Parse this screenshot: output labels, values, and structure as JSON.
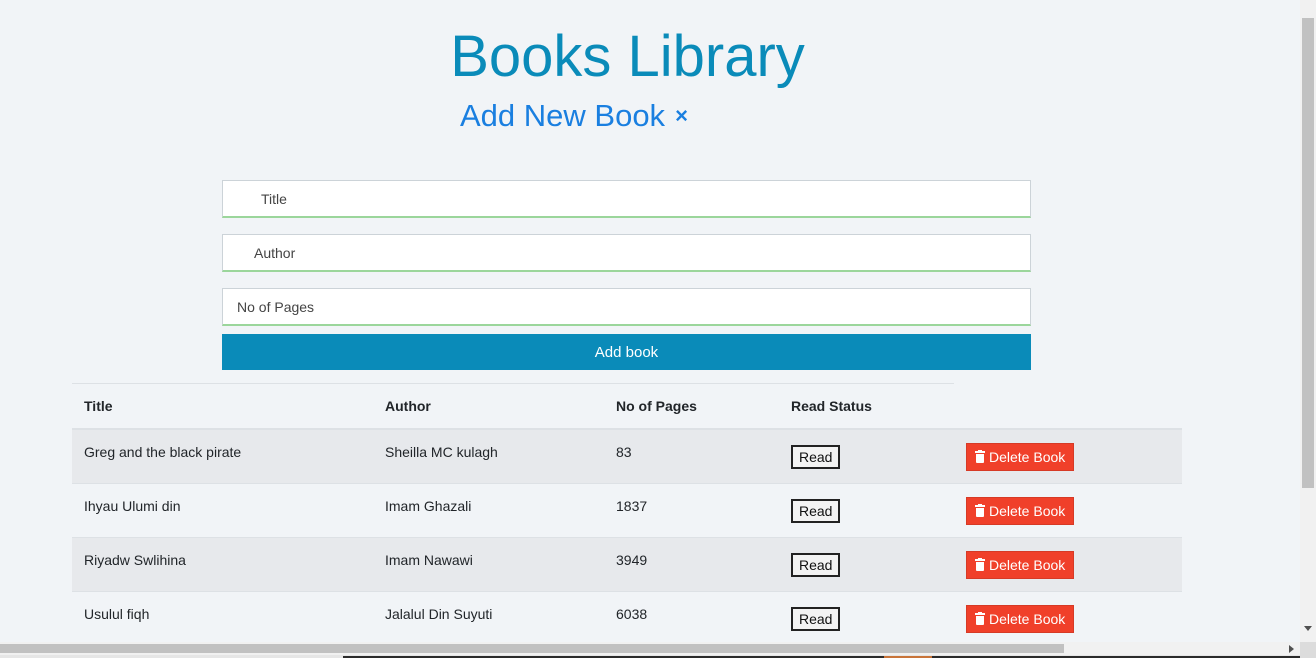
{
  "header": {
    "title": "Books Library",
    "add_new_label": "Add New Book",
    "close_glyph": "×"
  },
  "form": {
    "title_placeholder": "Title",
    "author_placeholder": "Author",
    "pages_placeholder": "No of Pages",
    "submit_label": "Add book"
  },
  "table": {
    "headers": [
      "Title",
      "Author",
      "No of Pages",
      "Read Status"
    ],
    "rows": [
      {
        "title": "Greg and the black pirate",
        "author": "Sheilla MC kulagh",
        "pages": "83",
        "status": "Read",
        "delete": "Delete Book"
      },
      {
        "title": "Ihyau Ulumi din",
        "author": "Imam Ghazali",
        "pages": "1837",
        "status": "Read",
        "delete": "Delete Book"
      },
      {
        "title": "Riyadw Swlihina",
        "author": "Imam Nawawi",
        "pages": "3949",
        "status": "Read",
        "delete": "Delete Book"
      },
      {
        "title": "Usulul fiqh",
        "author": "Jalalul Din Suyuti",
        "pages": "6038",
        "status": "Read",
        "delete": "Delete Book"
      }
    ]
  },
  "icons": {
    "close": "close-icon",
    "trash": "trash-icon"
  },
  "colors": {
    "title": "#0a8bb9",
    "add_new": "#1a7fe0",
    "primary_button": "#0a8bb9",
    "delete_button": "#f0402a",
    "input_underline": "#9bd69b"
  }
}
